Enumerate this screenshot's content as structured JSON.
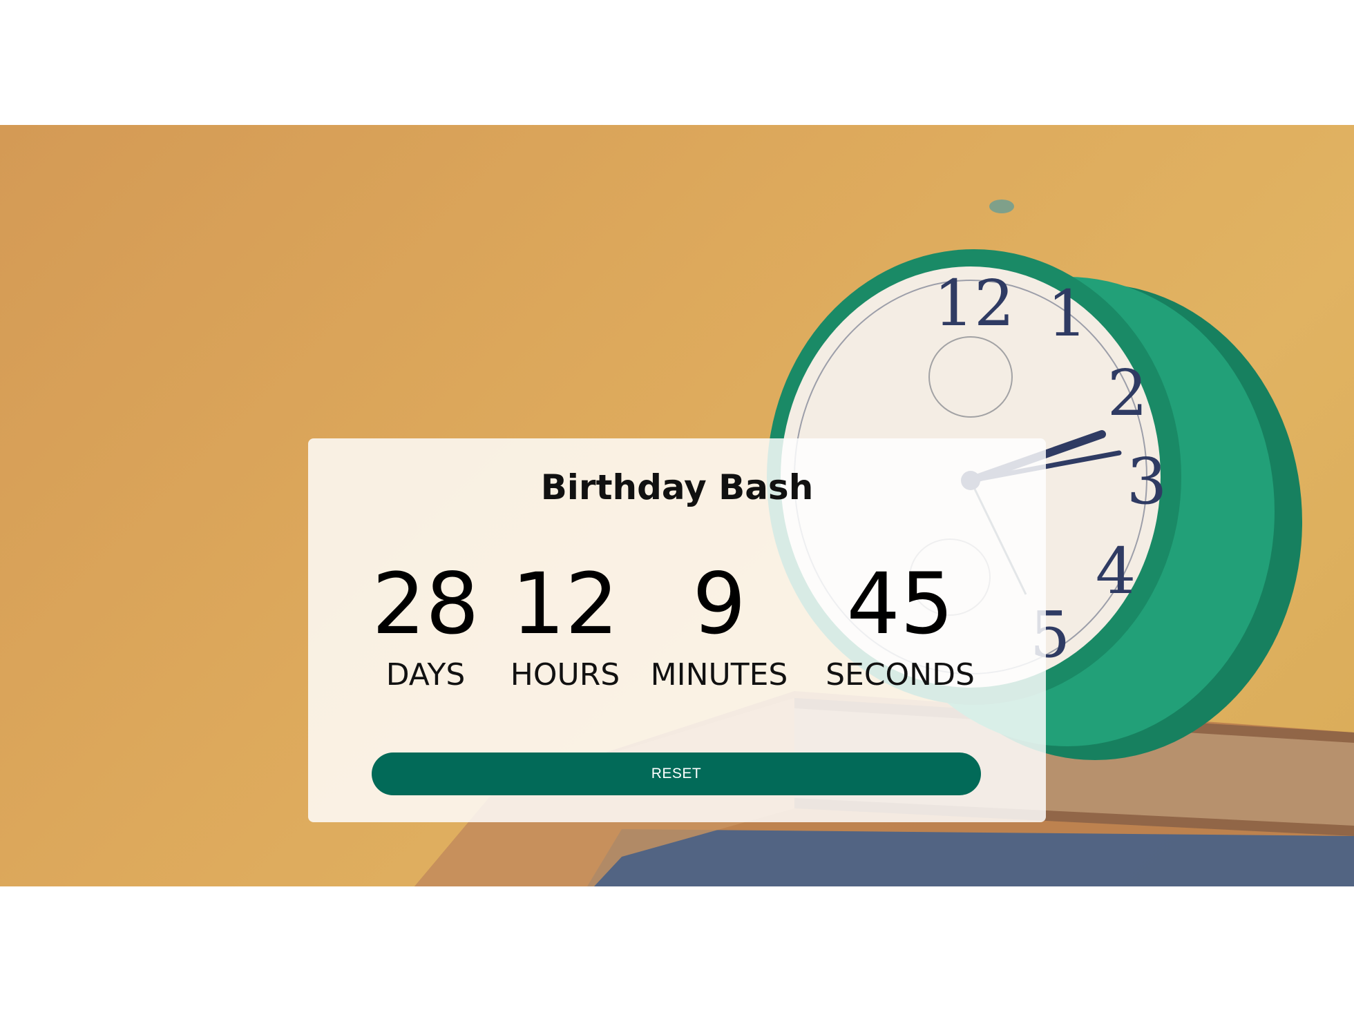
{
  "colors": {
    "background_warm": "#dda95c",
    "clock_green": "#1e9a72",
    "button": "#026a58",
    "button_text": "#ffffff"
  },
  "background": {
    "subject": "alarm-clock-on-books-photo"
  },
  "event": {
    "title": "Birthday Bash"
  },
  "countdown": {
    "days": {
      "value": "28",
      "label": "DAYS"
    },
    "hours": {
      "value": "12",
      "label": "HOURS"
    },
    "minutes": {
      "value": "9",
      "label": "MINUTES"
    },
    "seconds": {
      "value": "45",
      "label": "SECONDS"
    }
  },
  "actions": {
    "reset_label": "RESET"
  }
}
